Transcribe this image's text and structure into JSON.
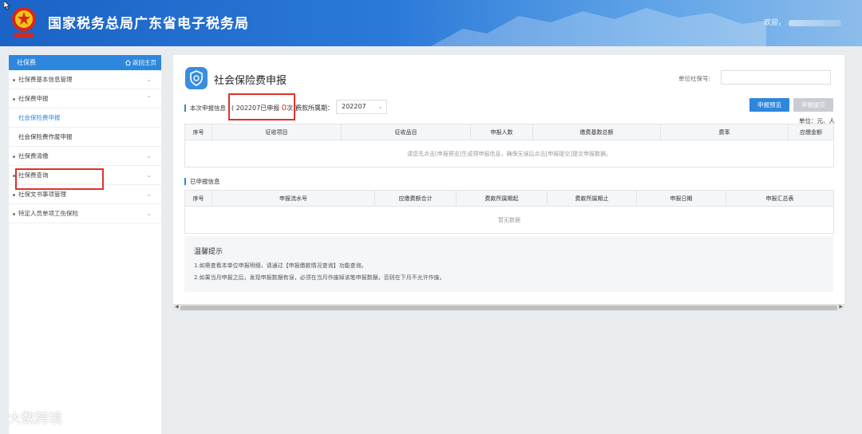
{
  "header": {
    "title": "国家税务总局广东省电子税务局",
    "welcome": "欢迎，"
  },
  "sidebar": {
    "title": "社保费",
    "home_link": "返回主页",
    "items": [
      {
        "label": "社保费基本信息管理"
      },
      {
        "label": "社保费申报",
        "expanded": true,
        "children": [
          {
            "label": "社会保险费申报",
            "active": true
          },
          {
            "label": "社会保险费作废申报"
          }
        ]
      },
      {
        "label": "社保费清缴"
      },
      {
        "label": "社保费查询"
      },
      {
        "label": "社保文书事项管理"
      },
      {
        "label": "特定人员单项工伤保险"
      }
    ]
  },
  "main": {
    "page_title": "社会保险费申报",
    "unit_label": "单位社保号:",
    "current_section": "本次申报信息",
    "count_prefix": "( 202207已申报",
    "count_value": "0",
    "count_suffix": "次 )",
    "period_label": "费款所属期：",
    "period_value": "202207",
    "preview_button": "申报预览",
    "submit_button": "申报提交",
    "unit_note": "单位：元、人",
    "table1": {
      "headers": [
        "序号",
        "征收项目",
        "征收品目",
        "申报人数",
        "缴费基数总额",
        "费率",
        "应缴金额"
      ],
      "empty_message": "请您先点击[申报预览]生成预申报信息，确保无误后点击[申报提交]提交申报数据。"
    },
    "declared_section": "已申报信息",
    "table2": {
      "headers": [
        "序号",
        "申报流水号",
        "应缴费额合计",
        "费款所属期起",
        "费款所属期止",
        "申报日期",
        "申报汇总表"
      ],
      "empty_message": "暂无数据"
    },
    "tips": {
      "title": "温馨提示",
      "lines": [
        "1.如需查看本单位申报明细，请通过【申报缴款情况查询】功能查询。",
        "2.如果当月申报之后，发现申报数据有误，必须在当月作废掉该笔申报数据，否则在下月不允许作废。"
      ]
    }
  },
  "watermark": "大数跨境",
  "colors": {
    "brand_blue": "#2c87dd",
    "highlight_red": "#e0302a",
    "disabled_gray": "#c9ccd0"
  }
}
